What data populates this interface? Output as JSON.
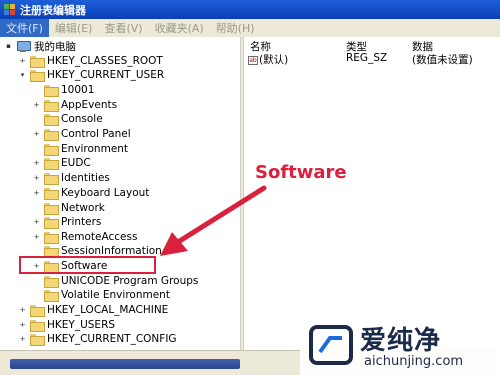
{
  "window": {
    "title": "注册表编辑器"
  },
  "menu": {
    "items": [
      "文件(F)",
      "编辑(E)",
      "查看(V)",
      "收藏夹(A)",
      "帮助(H)"
    ]
  },
  "tree": {
    "root": "我的电脑",
    "hkcr": "HKEY_CLASSES_ROOT",
    "hkcu": "HKEY_CURRENT_USER",
    "hkcu_children": [
      "10001",
      "AppEvents",
      "Console",
      "Control Panel",
      "Environment",
      "EUDC",
      "Identities",
      "Keyboard Layout",
      "Network",
      "Printers",
      "RemoteAccess",
      "SessionInformation",
      "Software",
      "UNICODE Program Groups",
      "Volatile Environment"
    ],
    "hklm": "HKEY_LOCAL_MACHINE",
    "hku": "HKEY_USERS",
    "hkcc": "HKEY_CURRENT_CONFIG"
  },
  "values_pane": {
    "headers": {
      "name": "名称",
      "type": "类型",
      "data": "数据"
    },
    "rows": [
      {
        "name": "(默认)",
        "type": "REG_SZ",
        "data": "(数值未设置)"
      }
    ]
  },
  "annotation": {
    "label": "Software",
    "color": "#d9203c"
  },
  "watermark": {
    "title": "爱纯净",
    "url": "aichunjing.com"
  },
  "colors": {
    "titlebar": "#0a3fb6",
    "menubar": "#ece9d8",
    "annotation": "#d9203c"
  }
}
